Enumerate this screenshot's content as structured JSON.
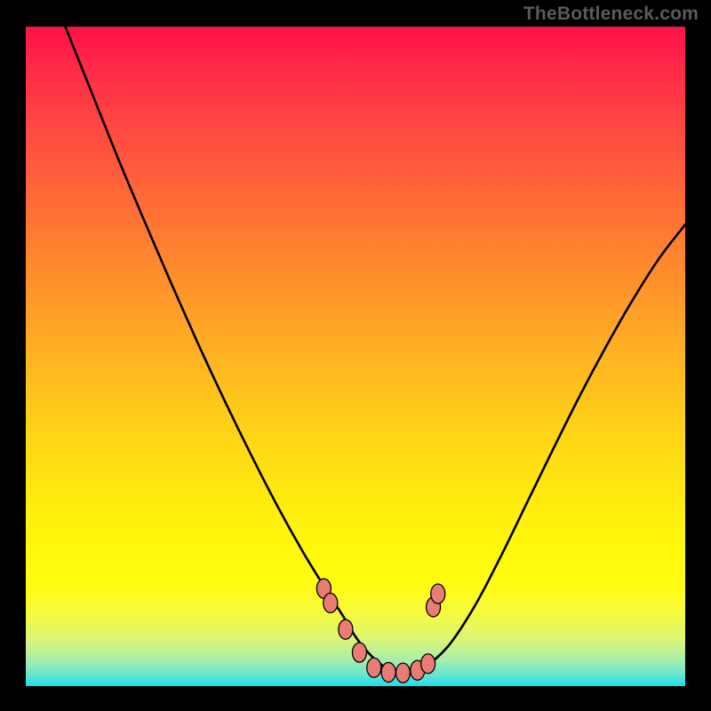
{
  "attribution": "TheBottleneck.com",
  "colors": {
    "curve": "#000000",
    "marker_fill": "#E97C74",
    "marker_stroke": "#000000",
    "bg": "#000000"
  },
  "chart_data": {
    "type": "line",
    "title": "",
    "xlabel": "",
    "ylabel": "",
    "xlim": [
      0,
      100
    ],
    "ylim": [
      0,
      100
    ],
    "series": [
      {
        "name": "bottleneck-curve",
        "x": [
          6,
          10,
          14,
          18,
          22,
          26,
          30,
          34,
          38,
          42,
          45,
          48,
          50,
          52,
          54,
          56,
          58,
          60,
          64,
          68,
          72,
          76,
          80,
          84,
          88,
          92,
          96,
          100
        ],
        "y": [
          100,
          90,
          80,
          70.5,
          61.2,
          52.2,
          43.6,
          35.4,
          27.6,
          20.4,
          15.5,
          10.8,
          7.5,
          5,
          3.2,
          2.2,
          2,
          2.5,
          6,
          12,
          19.6,
          27.8,
          36,
          44,
          51.5,
          58.5,
          64.8,
          70
        ]
      }
    ],
    "markers": [
      {
        "x": 45.2,
        "y": 14.8
      },
      {
        "x": 46.2,
        "y": 12.6
      },
      {
        "x": 48.5,
        "y": 8.6
      },
      {
        "x": 50.6,
        "y": 5.1
      },
      {
        "x": 52.8,
        "y": 2.8
      },
      {
        "x": 55.0,
        "y": 2.1
      },
      {
        "x": 57.2,
        "y": 2.0
      },
      {
        "x": 59.4,
        "y": 2.4
      },
      {
        "x": 61.0,
        "y": 3.4
      },
      {
        "x": 61.8,
        "y": 12.0
      },
      {
        "x": 62.5,
        "y": 14.0
      }
    ]
  }
}
